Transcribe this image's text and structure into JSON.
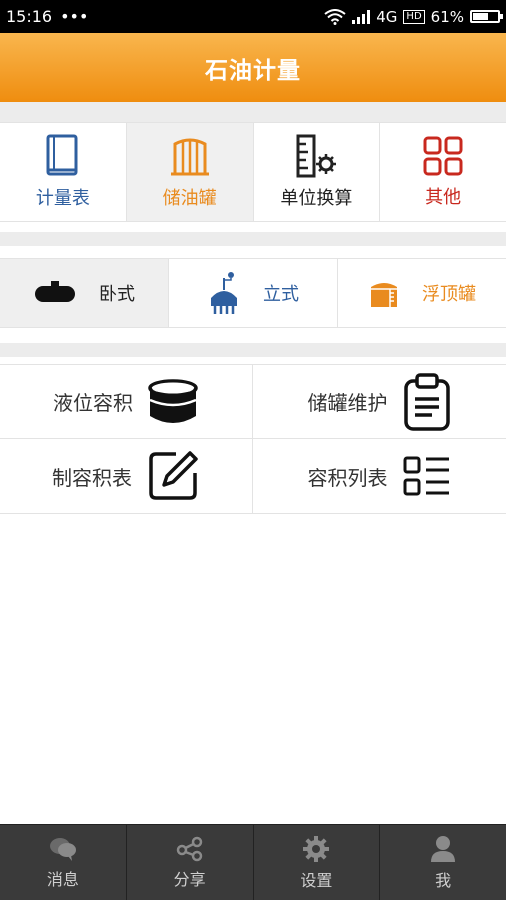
{
  "status": {
    "time": "15:16",
    "dots": "•••",
    "network": "4G",
    "hd": "HD",
    "battery": "61%",
    "battery_level": 0.61
  },
  "app": {
    "title": "石油计量"
  },
  "categories": [
    {
      "label": "计量表",
      "color": "#2f5f9f",
      "icon": "book-icon"
    },
    {
      "label": "储油罐",
      "color": "#e98b1f",
      "icon": "tank-icon",
      "selected": true
    },
    {
      "label": "单位换算",
      "color": "#222222",
      "icon": "ruler-gear-icon"
    },
    {
      "label": "其他",
      "color": "#c8281e",
      "icon": "grid-icon"
    }
  ],
  "tank_types": [
    {
      "label": "卧式",
      "color": "#222222",
      "icon": "horizontal-tank-icon",
      "selected": true
    },
    {
      "label": "立式",
      "color": "#2f5f9f",
      "icon": "vertical-tank-icon"
    },
    {
      "label": "浮顶罐",
      "color": "#e98b1f",
      "icon": "floating-roof-tank-icon"
    }
  ],
  "functions": [
    {
      "label": "液位容积",
      "icon": "cylinder-icon"
    },
    {
      "label": "储罐维护",
      "icon": "clipboard-icon"
    },
    {
      "label": "制容积表",
      "icon": "edit-icon"
    },
    {
      "label": "容积列表",
      "icon": "list-icon"
    }
  ],
  "tabs": [
    {
      "label": "消息",
      "icon": "message-icon"
    },
    {
      "label": "分享",
      "icon": "share-icon"
    },
    {
      "label": "设置",
      "icon": "gear-icon"
    },
    {
      "label": "我",
      "icon": "user-icon"
    }
  ]
}
